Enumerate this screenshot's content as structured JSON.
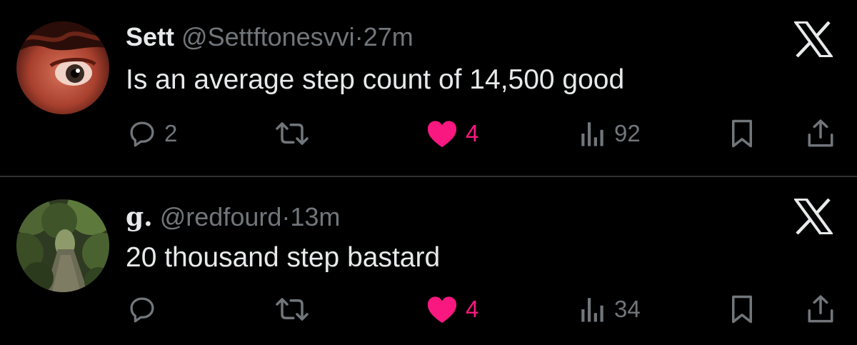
{
  "tweets": [
    {
      "name": "Sett",
      "handle": "@Settftonesvvi",
      "separator": "·",
      "time": "27m",
      "text": "Is an average step count of 14,500 good",
      "replies": "2",
      "retweets": "",
      "likes": "4",
      "views": "92",
      "liked": true
    },
    {
      "name": "g.",
      "handle": "@redfourd",
      "separator": "·",
      "time": "13m",
      "text": "20 thousand step bastard",
      "replies": "",
      "retweets": "",
      "likes": "4",
      "views": "34",
      "liked": true
    }
  ],
  "colors": {
    "background": "#000000",
    "text": "#e7e9ea",
    "muted": "#71767b",
    "like": "#f91880",
    "divider": "#2f3336"
  },
  "icons": [
    "reply-icon",
    "retweet-icon",
    "heart-icon",
    "views-icon",
    "bookmark-icon",
    "share-icon",
    "x-logo-icon"
  ]
}
